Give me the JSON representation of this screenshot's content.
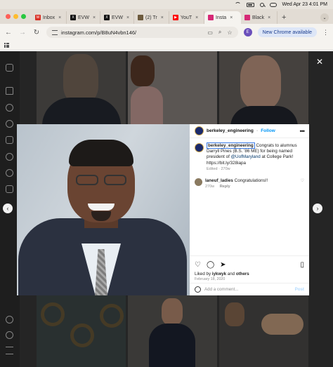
{
  "menubar": {
    "datetime": "Wed Apr 23  4:01 PM",
    "icons": [
      "wifi-icon",
      "battery-icon",
      "search-icon",
      "control-center-icon"
    ]
  },
  "tabs": [
    {
      "label": "Inbox",
      "icon": "gmail-icon",
      "color": "#d93025"
    },
    {
      "label": "EVW",
      "icon": "x-icon",
      "color": "#111111"
    },
    {
      "label": "EVW",
      "icon": "x-icon",
      "color": "#111111"
    },
    {
      "label": "(2) Tr",
      "icon": "site-icon",
      "color": "#6d5a3d"
    },
    {
      "label": "YouT",
      "icon": "youtube-icon",
      "color": "#ff0000"
    },
    {
      "label": "Insta",
      "icon": "instagram-icon",
      "color": "#d62976",
      "active": true
    },
    {
      "label": "Black",
      "icon": "instagram-icon",
      "color": "#d62976"
    }
  ],
  "navbar": {
    "url": "instagram.com/p/B8uN4vbn146/",
    "profile_initial": "E",
    "update_label": "New Chrome available"
  },
  "post": {
    "username": "berkeley_engineering",
    "follow_label": "Follow",
    "caption_user": "berkeley_engineering",
    "caption_part1": " Congrats to alumnus Darryll Pines (B.S. '86 ME) for being named president of ",
    "caption_mention": "@UofMaryland",
    "caption_part2": " at College Park! https://bit.ly/328iapa",
    "caption_meta": "Edited · 270w",
    "comment_user": "laneuf_ladies",
    "comment_text": " Congratulations!!",
    "comment_age": "270w",
    "comment_reply": "Reply",
    "liked_prefix": "Liked by ",
    "liked_user": "iykwyk",
    "liked_and": " and ",
    "liked_others": "others",
    "date": "February 18, 2020",
    "add_comment_placeholder": "Add a comment...",
    "post_label": "Post"
  }
}
